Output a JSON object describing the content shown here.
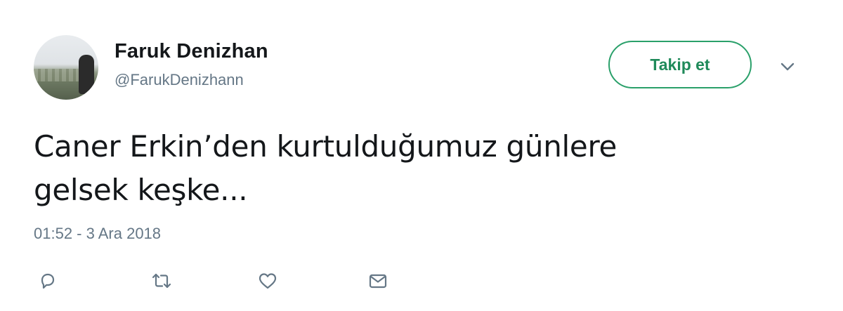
{
  "author": {
    "name": "Faruk Denizhan",
    "handle": "@FarukDenizhann"
  },
  "follow_button": {
    "label": "Takip et"
  },
  "tweet": {
    "text_line1": "Caner Erkin’den kurtulduğumuz günlere",
    "text_line2": "gelsek keşke...",
    "timestamp": "01:52 - 3 Ara 2018"
  },
  "icons": {
    "menu": "chevron-down-icon",
    "reply": "reply-icon",
    "retweet": "retweet-icon",
    "like": "heart-icon",
    "message": "envelope-icon"
  },
  "colors": {
    "follow_accent": "#2aa06a",
    "text": "#14171a",
    "muted": "#657786"
  }
}
